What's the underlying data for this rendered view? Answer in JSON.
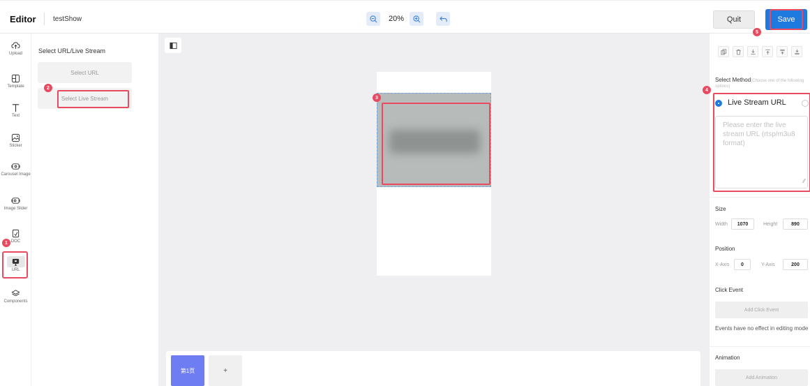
{
  "header": {
    "brand": "Editor",
    "project_name": "testShow",
    "zoom": "20%",
    "quit_label": "Quit",
    "save_label": "Save"
  },
  "rail": {
    "items": [
      {
        "label": "Upload",
        "icon": "upload-icon"
      },
      {
        "label": "Template",
        "icon": "template-icon"
      },
      {
        "label": "Text",
        "icon": "text-icon"
      },
      {
        "label": "Sticker",
        "icon": "sticker-icon"
      },
      {
        "label": "Carousel Image",
        "icon": "carousel-image-icon"
      },
      {
        "label": "Image Slider",
        "icon": "image-slider-icon"
      },
      {
        "label": "DOC",
        "icon": "doc-icon"
      },
      {
        "label": "URL",
        "icon": "url-icon"
      },
      {
        "label": "Components",
        "icon": "components-icon"
      }
    ]
  },
  "panel": {
    "title": "Select URL/Live Stream",
    "select_url": "Select URL",
    "select_live_stream": "Select Live Stream"
  },
  "pages": {
    "current": "第1页",
    "add": "+"
  },
  "properties": {
    "select_method": "Select Method",
    "select_method_hint": "(Choose one of the following options)",
    "live_stream_label": "Live Stream URL",
    "url_placeholder": "Please enter the live stream URL (rtsp/m3u8 format)",
    "size_title": "Size",
    "width_label": "Width",
    "width_value": "1070",
    "height_label": "Height",
    "height_value": "890",
    "position_title": "Position",
    "x_label": "X-Axis",
    "x_value": "0",
    "y_label": "Y-Axis",
    "y_value": "200",
    "click_event_title": "Click Event",
    "add_click_event": "Add Click Event",
    "events_note": "Events have no effect in editing mode",
    "animation_title": "Animation",
    "add_animation": "Add Animation"
  },
  "steps": [
    "1",
    "2",
    "3",
    "4",
    "5"
  ],
  "colors": {
    "accent": "#1f7ae0",
    "highlight": "#e84a5f",
    "page_tab": "#6e7ef2"
  }
}
